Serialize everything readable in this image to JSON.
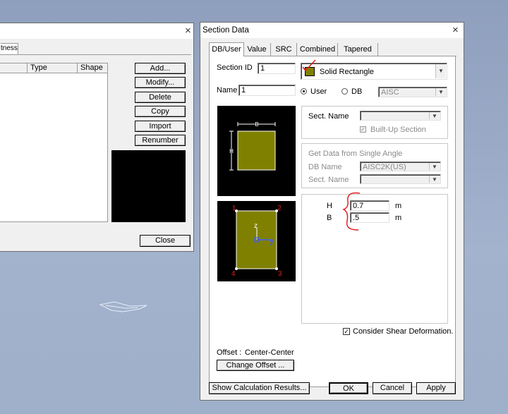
{
  "colors": {
    "section_fill": "#808000",
    "annotation_red": "#e02020",
    "canvas_bg": "#000000"
  },
  "left_window": {
    "close_icon": "×",
    "tab_partial": "tness",
    "columns": [
      "Type",
      "Shape"
    ],
    "buttons": {
      "add": "Add...",
      "modify": "Modify...",
      "delete": "Delete",
      "copy": "Copy",
      "import": "Import",
      "renumber": "Renumber"
    },
    "close_label": "Close"
  },
  "dialog": {
    "title": "Section Data",
    "close_icon": "×",
    "tabs": [
      "DB/User",
      "Value",
      "SRC",
      "Combined",
      "Tapered"
    ],
    "section_id_label": "Section ID",
    "section_id_value": "1",
    "shape_selected": "Solid Rectangle",
    "name_label": "Name",
    "name_value": "1",
    "user_label": "User",
    "db_label": "DB",
    "db_value": "AISC",
    "sect_name_label": "Sect. Name",
    "builtup_label": "Built-Up Section",
    "single_angle_title": "Get Data from Single Angle",
    "db_name_label": "DB Name",
    "db_name_value": "AISC2K(US)",
    "sect_name2_label": "Sect. Name",
    "preview": {
      "b_label": "B",
      "h_label": "H",
      "corners": [
        "1",
        "2",
        "3",
        "4"
      ],
      "z_axis": "z",
      "y_axis": "y"
    },
    "dims": [
      {
        "label": "H",
        "value": "0.7",
        "unit": "m"
      },
      {
        "label": "B",
        "value": ".5",
        "unit": "m"
      }
    ],
    "shear_label": "Consider Shear Deformation.",
    "offset_label": "Offset :",
    "offset_value": "Center-Center",
    "change_offset": "Change Offset ...",
    "buttons": {
      "show_calc": "Show Calculation Results...",
      "ok": "OK",
      "cancel": "Cancel",
      "apply": "Apply"
    }
  }
}
